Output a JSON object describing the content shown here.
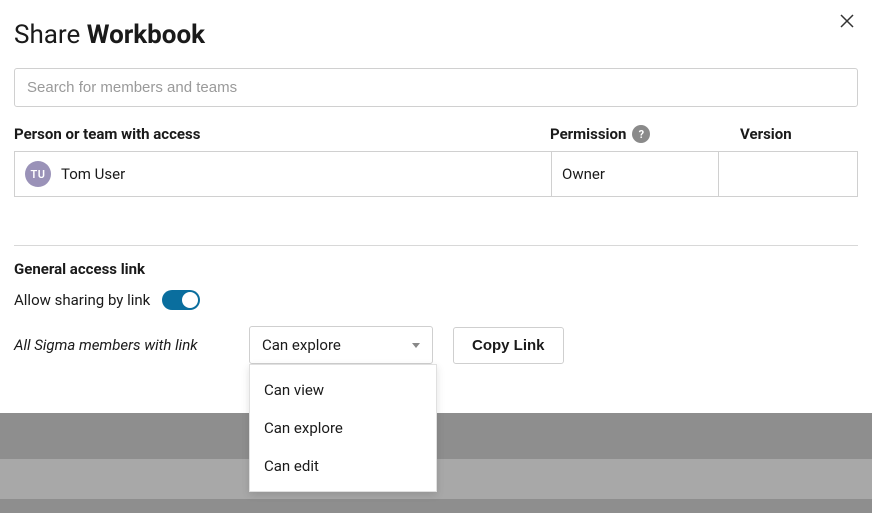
{
  "dialog": {
    "title_prefix": "Share ",
    "title_bold": "Workbook"
  },
  "search": {
    "placeholder": "Search for members and teams"
  },
  "columns": {
    "person": "Person or team with access",
    "permission": "Permission",
    "version": "Version",
    "help_glyph": "?"
  },
  "access_rows": [
    {
      "avatar_initials": "TU",
      "name": "Tom User",
      "permission": "Owner",
      "version": ""
    }
  ],
  "general": {
    "heading": "General access link",
    "allow_label": "Allow sharing by link",
    "allow_enabled": true,
    "scope_label": "All Sigma members with link",
    "selected_permission": "Can explore",
    "options": [
      "Can view",
      "Can explore",
      "Can edit"
    ],
    "copy_button": "Copy Link"
  }
}
